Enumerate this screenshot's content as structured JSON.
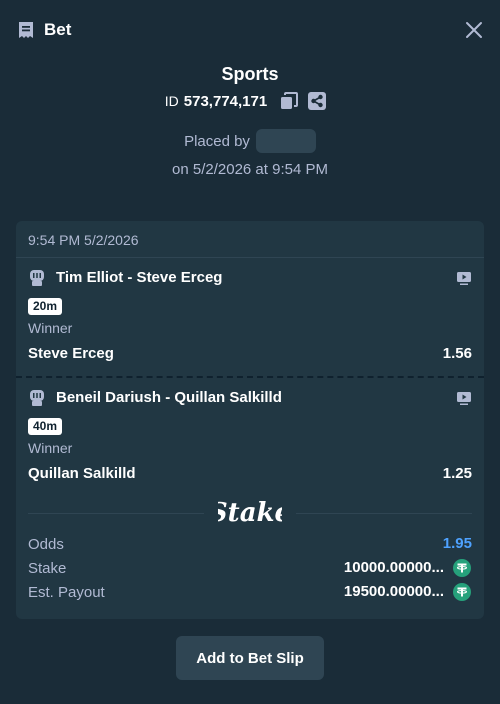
{
  "header": {
    "title": "Bet",
    "icon": "receipt-icon",
    "close_icon": "close-icon"
  },
  "bet": {
    "category": "Sports",
    "id_label": "ID",
    "id_value": "573,774,171",
    "placed_by_label": "Placed by",
    "placed_on": "on 5/2/2026 at 9:54 PM"
  },
  "card": {
    "timestamp": "9:54 PM 5/2/2026",
    "legs": [
      {
        "event": "Tim Elliot - Steve Erceg",
        "badge": "20m",
        "market": "Winner",
        "selection": "Steve Erceg",
        "odds": "1.56",
        "sport_icon": "mma-glove-icon",
        "stream_icon": "live-stream-icon"
      },
      {
        "event": "Beneil Dariush - Quillan Salkilld",
        "badge": "40m",
        "market": "Winner",
        "selection": "Quillan Salkilld",
        "odds": "1.25",
        "sport_icon": "mma-glove-icon",
        "stream_icon": "live-stream-icon"
      }
    ],
    "brand": "Stake",
    "summary": {
      "odds_label": "Odds",
      "odds_value": "1.95",
      "stake_label": "Stake",
      "stake_value": "10000.00000...",
      "payout_label": "Est. Payout",
      "payout_value": "19500.00000...",
      "currency_icon": "tether-icon"
    }
  },
  "actions": {
    "add_to_slip": "Add to Bet Slip"
  },
  "colors": {
    "background": "#1a2c38",
    "card": "#213743",
    "muted_text": "#b1bad3",
    "accent_blue": "#4ea2ff",
    "tether_green": "#26a17b",
    "button": "#2f4553"
  }
}
